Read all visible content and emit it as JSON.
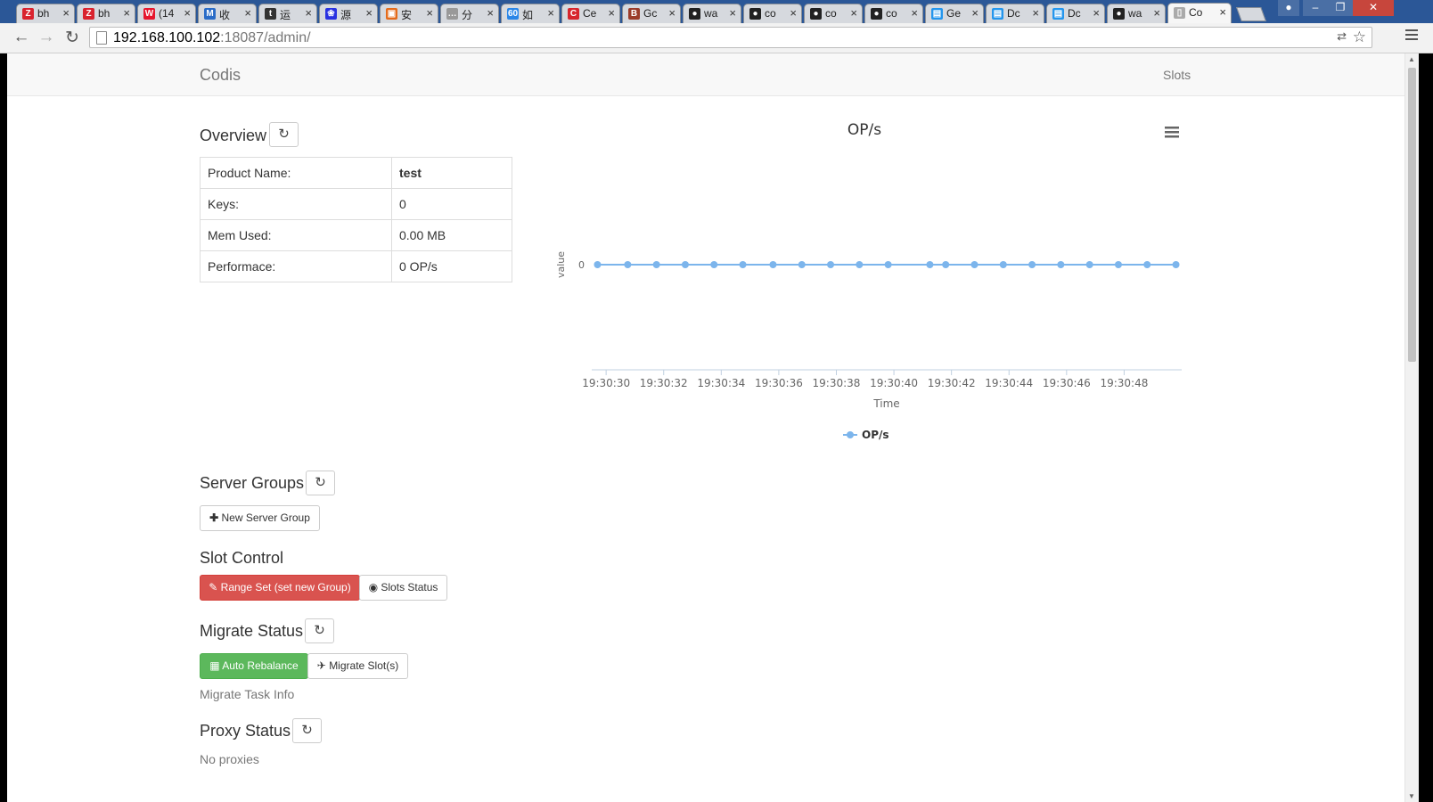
{
  "browser": {
    "tabs": [
      {
        "label": "bh",
        "icon": "zhihu-red-icon",
        "color": "#d9232e"
      },
      {
        "label": "bh",
        "icon": "zhihu-red-icon",
        "color": "#d9232e"
      },
      {
        "label": "(14",
        "icon": "weibo-icon",
        "color": "#e6162d"
      },
      {
        "label": "收",
        "icon": "mail-icon",
        "color": "#2a6cc7"
      },
      {
        "label": "运",
        "icon": "t-icon",
        "color": "#333333"
      },
      {
        "label": "源",
        "icon": "baidu-paw-icon",
        "color": "#2932e1"
      },
      {
        "label": "安",
        "icon": "box-icon",
        "color": "#e46b1b"
      },
      {
        "label": "分",
        "icon": "dots-icon",
        "color": "#999999"
      },
      {
        "label": "如",
        "icon": "go-icon",
        "color": "#2a86e8"
      },
      {
        "label": "Ce",
        "icon": "c-icon",
        "color": "#d7262d"
      },
      {
        "label": "Gc",
        "icon": "b-icon",
        "color": "#9b3c2a"
      },
      {
        "label": "wa",
        "icon": "github-icon",
        "color": "#222222"
      },
      {
        "label": "co",
        "icon": "github-icon",
        "color": "#222222"
      },
      {
        "label": "co",
        "icon": "github-icon",
        "color": "#222222"
      },
      {
        "label": "co",
        "icon": "github-icon",
        "color": "#222222"
      },
      {
        "label": "Ge",
        "icon": "docker-icon",
        "color": "#2496ed"
      },
      {
        "label": "Dc",
        "icon": "docker-icon",
        "color": "#2496ed"
      },
      {
        "label": "Dc",
        "icon": "docker-icon",
        "color": "#2496ed"
      },
      {
        "label": "wa",
        "icon": "github-icon",
        "color": "#222222"
      },
      {
        "label": "Co",
        "icon": "page-icon",
        "color": "#aaaaaa"
      }
    ],
    "url_host": "192.168.100.102",
    "url_rest": ":18087/admin/"
  },
  "navbar": {
    "brand": "Codis",
    "slots_link": "Slots"
  },
  "overview": {
    "title": "Overview",
    "rows": [
      {
        "key": "Product Name:",
        "value": "test"
      },
      {
        "key": "Keys:",
        "value": "0"
      },
      {
        "key": "Mem Used:",
        "value": "0.00 MB"
      },
      {
        "key": "Performace:",
        "value": "0 OP/s"
      }
    ]
  },
  "server_groups": {
    "title": "Server Groups",
    "new_button": "New Server Group"
  },
  "slot_control": {
    "title": "Slot Control",
    "range_set_button": "Range Set (set new Group)",
    "slots_status_button": "Slots Status"
  },
  "migrate": {
    "title": "Migrate Status",
    "auto_rebalance_button": "Auto Rebalance",
    "migrate_slots_button": "Migrate Slot(s)",
    "task_info": "Migrate Task Info"
  },
  "proxy": {
    "title": "Proxy Status",
    "empty_text": "No proxies"
  },
  "chart_data": {
    "type": "line",
    "title": "OP/s",
    "xlabel": "Time",
    "ylabel": "value",
    "x": [
      "19:30:29.7",
      "19:30:30.8",
      "19:30:31.8",
      "19:30:32.8",
      "19:30:33.8",
      "19:30:34.8",
      "19:30:35.8",
      "19:30:36.8",
      "19:30:37.8",
      "19:30:38.8",
      "19:30:39.8",
      "19:30:41.3",
      "19:30:41.8",
      "19:30:42.8",
      "19:30:43.8",
      "19:30:44.8",
      "19:30:45.8",
      "19:30:46.8",
      "19:30:47.8",
      "19:30:48.8",
      "19:30:49.8"
    ],
    "x_seconds": [
      29.7,
      30.75,
      31.75,
      32.75,
      33.75,
      34.75,
      35.8,
      36.8,
      37.8,
      38.8,
      39.8,
      41.25,
      41.8,
      42.8,
      43.8,
      44.8,
      45.8,
      46.8,
      47.8,
      48.8,
      49.8
    ],
    "series": [
      {
        "name": "OP/s",
        "values": [
          0,
          0,
          0,
          0,
          0,
          0,
          0,
          0,
          0,
          0,
          0,
          0,
          0,
          0,
          0,
          0,
          0,
          0,
          0,
          0,
          0
        ]
      }
    ],
    "xticks": [
      "19:30:30",
      "19:30:32",
      "19:30:34",
      "19:30:36",
      "19:30:38",
      "19:30:40",
      "19:30:42",
      "19:30:44",
      "19:30:46",
      "19:30:48"
    ],
    "xtick_seconds": [
      30,
      32,
      34,
      36,
      38,
      40,
      42,
      44,
      46,
      48
    ],
    "xlim_seconds": [
      29.5,
      50
    ],
    "yticks": [
      "0"
    ],
    "legend": "bottom-center",
    "series_color": "#7cb5ec"
  }
}
